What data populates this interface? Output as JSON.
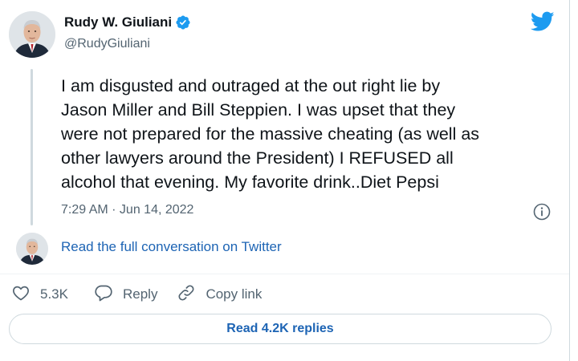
{
  "author": {
    "display_name": "Rudy W. Giuliani",
    "handle": "@RudyGiuliani",
    "verified": true
  },
  "tweet": {
    "text": "I am disgusted and outraged at the out right lie by\nJason Miller and Bill Steppien. I was upset that they\nwere not prepared for the massive cheating (as well as\nother lawyers around the President) I REFUSED all\nalcohol that evening. My favorite drink..Diet Pepsi",
    "timestamp": "7:29 AM · Jun 14, 2022"
  },
  "conversation_link": "Read the full conversation on Twitter",
  "actions": {
    "like_count": "5.3K",
    "reply_label": "Reply",
    "copy_link_label": "Copy link"
  },
  "read_replies_label": "Read 4.2K replies",
  "icons": {
    "brand": "twitter-bird-icon",
    "verified": "verified-badge-icon",
    "info": "info-icon",
    "like": "heart-icon",
    "reply": "speech-bubble-icon",
    "copy_link": "link-icon"
  },
  "colors": {
    "twitter_blue": "#1d9bf0",
    "link_blue": "#1d64b4",
    "secondary_text": "#536471",
    "border": "#cfd9de"
  }
}
